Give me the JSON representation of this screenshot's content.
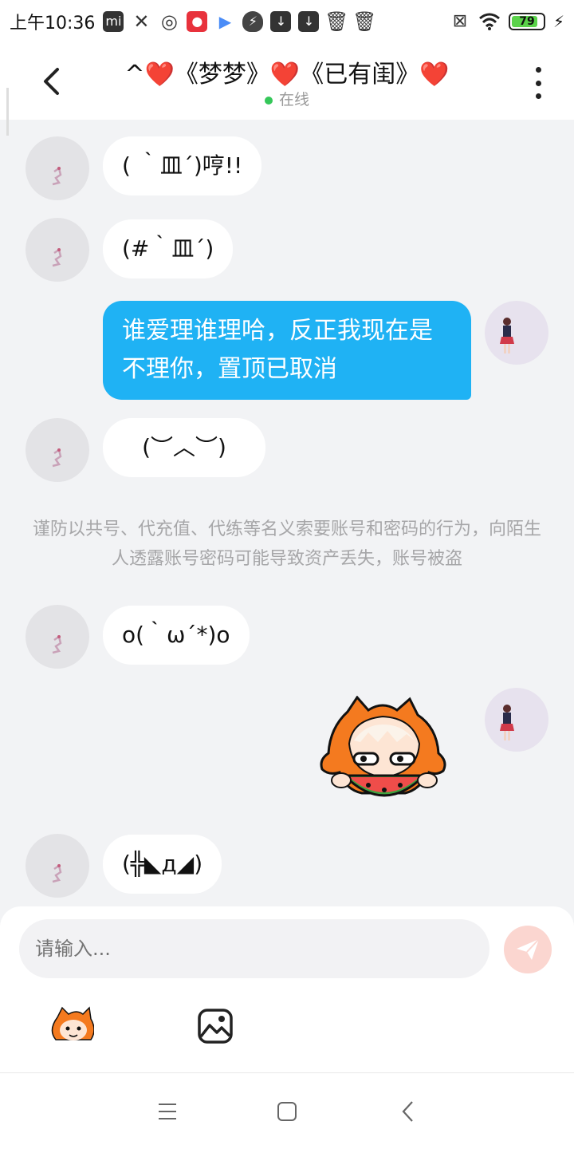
{
  "status_bar": {
    "time": "上午10:36",
    "battery": "79",
    "icons": [
      "mi-icon",
      "x-icon",
      "camera-icon",
      "record-icon",
      "play-store-icon",
      "shield-icon",
      "download-icon",
      "download-icon",
      "trash-icon",
      "trash-icon"
    ]
  },
  "header": {
    "title": "^❤️《梦梦》❤️《已有闺》❤️",
    "status": "在线",
    "back_icon": "back-arrow-icon",
    "more_icon": "more-vertical-icon"
  },
  "messages": [
    {
      "from": "other",
      "text": "(  ｀皿´)哼!!"
    },
    {
      "from": "other",
      "text": "(#｀皿´)"
    },
    {
      "from": "me",
      "text": "谁爱理谁理哈，反正我现在是不理你，置顶已取消"
    },
    {
      "from": "other",
      "text": "(︶︿︶)"
    },
    {
      "from": "notice",
      "text": "谨防以共号、代充值、代练等名义索要账号和密码的行为，向陌生人透露账号密码可能导致资产丢失，账号被盗"
    },
    {
      "from": "other",
      "text": "o(｀ω´*)o"
    },
    {
      "from": "me",
      "type": "sticker",
      "sticker": "watermelon-girl-sticker"
    },
    {
      "from": "other",
      "text": "(╬◣д◢)"
    }
  ],
  "composer": {
    "placeholder": "请输入...",
    "send_icon": "send-icon",
    "tools": [
      "sticker-icon",
      "image-icon"
    ]
  },
  "colors": {
    "my_bubble": "#1fb2f4",
    "online_dot": "#35c759",
    "background": "#f2f3f5"
  }
}
